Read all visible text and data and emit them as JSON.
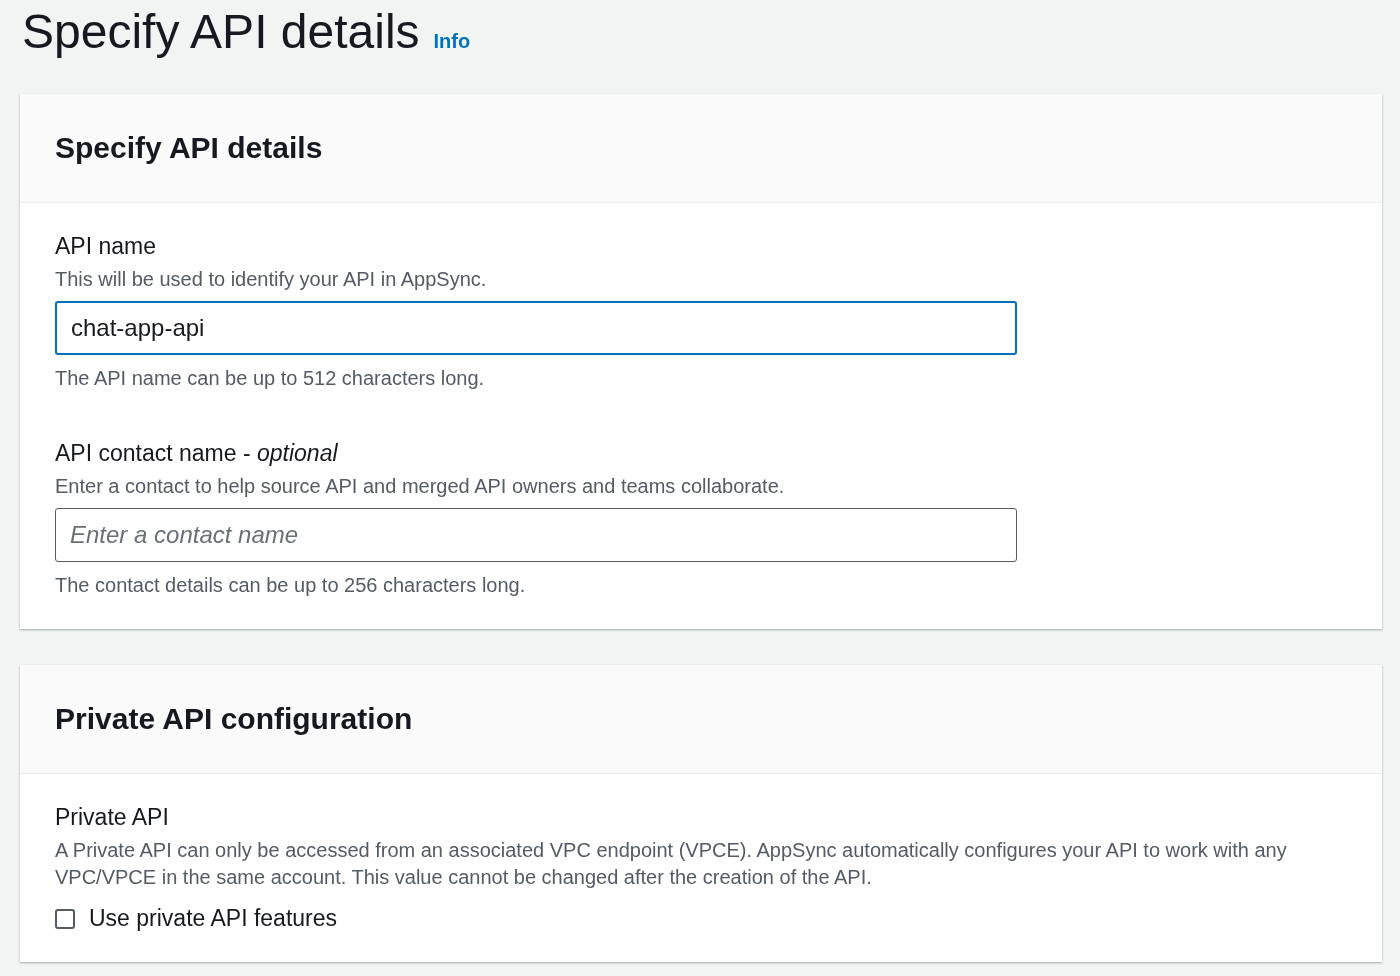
{
  "page": {
    "title": "Specify API details",
    "info_link": "Info"
  },
  "sections": [
    {
      "title": "Specify API details",
      "fields": [
        {
          "kind": "text",
          "label": "API name",
          "description": "This will be used to identify your API in AppSync.",
          "value": "chat-app-api",
          "focused": true,
          "constraint": "The API name can be up to 512 characters long."
        },
        {
          "kind": "text",
          "label": "API contact name - *optional*",
          "description": "Enter a contact to help source API and merged API owners and teams collaborate.",
          "placeholder": "Enter a contact name",
          "focused": false,
          "constraint": "The contact details can be up to 256 characters long."
        }
      ]
    },
    {
      "title": "Private API configuration",
      "fields": [
        {
          "kind": "checkbox",
          "label": "Private API",
          "description": "A Private API can only be accessed from an associated VPC endpoint (VPCE). AppSync automatically configures your API to work with any VPC/VPCE in the same account. This value cannot be changed after the creation of the API.",
          "option": "Use private API features",
          "checked": false
        }
      ]
    }
  ]
}
